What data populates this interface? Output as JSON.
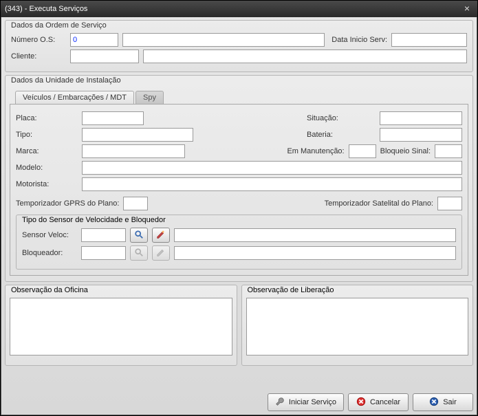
{
  "window": {
    "title": "(343) - Executa Serviços"
  },
  "group_os": {
    "legend": "Dados da Ordem de Serviço",
    "numero_os_label": "Número O.S:",
    "numero_os_value": "0",
    "numero_os_desc": "",
    "data_inicio_label": "Data Inicio Serv:",
    "data_inicio_value": "",
    "cliente_label": "Cliente:",
    "cliente_code": "",
    "cliente_name": ""
  },
  "group_unit": {
    "legend": "Dados da Unidade de Instalação",
    "tabs": {
      "veiculos": "Veículos / Embarcações / MDT",
      "spy": "Spy"
    },
    "placa_label": "Placa:",
    "placa_value": "",
    "situacao_label": "Situação:",
    "situacao_value": "",
    "tipo_label": "Tipo:",
    "tipo_value": "",
    "bateria_label": "Bateria:",
    "bateria_value": "",
    "marca_label": "Marca:",
    "marca_value": "",
    "em_manut_label": "Em Manutenção:",
    "em_manut_value": "",
    "bloqueio_sinal_label": "Bloqueio Sinal:",
    "bloqueio_sinal_value": "",
    "modelo_label": "Modelo:",
    "modelo_value": "",
    "motorista_label": "Motorista:",
    "motorista_value": "",
    "temp_gprs_label": "Temporizador GPRS do Plano:",
    "temp_gprs_value": "",
    "temp_sat_label": "Temporizador Satelital do Plano:",
    "temp_sat_value": ""
  },
  "sensor_group": {
    "legend": "Tipo do Sensor de Velocidade e Bloquedor",
    "sensor_veloc_label": "Sensor Veloc:",
    "sensor_veloc_value": "",
    "sensor_veloc_desc": "",
    "bloqueador_label": "Bloqueador:",
    "bloqueador_value": "",
    "bloqueador_desc": ""
  },
  "obs": {
    "oficina_legend": "Observação da Oficina",
    "oficina_text": "",
    "liberacao_legend": "Observação de Liberação",
    "liberacao_text": ""
  },
  "buttons": {
    "iniciar": "Iniciar Serviço",
    "cancelar": "Cancelar",
    "sair": "Sair"
  }
}
